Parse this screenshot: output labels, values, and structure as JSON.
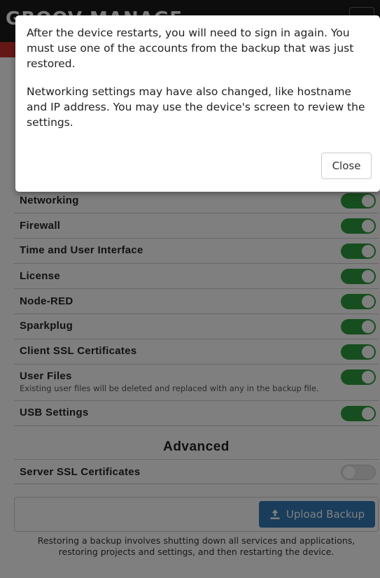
{
  "header": {
    "brand": "GROOV MANAGE"
  },
  "settings": [
    {
      "label": "Networking",
      "on": true
    },
    {
      "label": "Firewall",
      "on": true
    },
    {
      "label": "Time and User Interface",
      "on": true
    },
    {
      "label": "License",
      "on": true
    },
    {
      "label": "Node-RED",
      "on": true
    },
    {
      "label": "Sparkplug",
      "on": true
    },
    {
      "label": "Client SSL Certificates",
      "on": true
    },
    {
      "label": "User Files",
      "description": "Existing user files will be deleted and replaced with any in the backup file.",
      "on": true
    },
    {
      "label": "USB Settings",
      "on": true
    }
  ],
  "advanced": {
    "heading": "Advanced",
    "settings": [
      {
        "label": "Server SSL Certificates",
        "on": false
      }
    ]
  },
  "upload": {
    "button_label": "Upload Backup",
    "icon": "upload-icon",
    "note": "Restoring a backup involves shutting down all services and applications, restoring projects and settings, and then restarting the device."
  },
  "modal": {
    "paragraph1": "After the device restarts, you will need to sign in again. You must use one of the accounts from the backup that was just restored.",
    "paragraph2": "Networking settings may have also changed, like hostname and IP address. You may use the device's screen to review the settings.",
    "close_label": "Close"
  },
  "colors": {
    "toggle_on": "#2e9c3e",
    "toggle_off": "#e6e6e6",
    "primary_button": "#337ab7",
    "alert_bar": "#c9302c"
  }
}
